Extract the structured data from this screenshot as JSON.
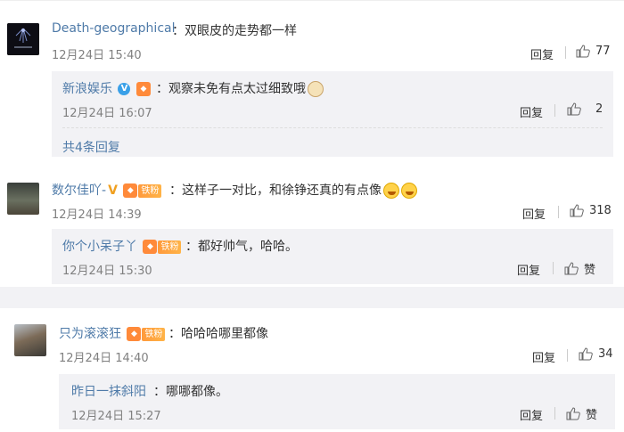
{
  "icons": {
    "like": "thumbs-up-icon",
    "verified": "v-badge-icon",
    "fan": "fan-badge-icon",
    "emoji": "emoji-icon"
  },
  "colors": {
    "name": "#4e7aa8",
    "reply_bg": "#f2f2f5",
    "verified_blue": "#3aa0e8",
    "verified_gold": "#f0a020",
    "badge_orange": "#ff8a3a"
  },
  "comments": [
    {
      "user": "Death-geographical",
      "text": "：双眼皮的走势都一样",
      "time": "12月24日 15:40",
      "reply_label": "回复",
      "likes": "77",
      "replies": [
        {
          "user": "新浪娱乐",
          "verified_mark": "V",
          "text": "：观察未免有点太过细致哦",
          "time": "12月24日 16:07",
          "reply_label": "回复",
          "likes": "2"
        }
      ],
      "more_replies": "共4条回复"
    },
    {
      "user": "数尔佳吖-",
      "verified_mark": "V",
      "fan_badge": "铁粉",
      "text": "：这样子一对比，和徐铮还真的有点像",
      "time": "12月24日 14:39",
      "reply_label": "回复",
      "likes": "318",
      "replies": [
        {
          "user": "你个小呆子丫",
          "fan_badge": "铁粉",
          "text": "：都好帅气，哈哈。",
          "time": "12月24日 15:30",
          "reply_label": "回复",
          "likes": "赞"
        }
      ]
    },
    {
      "user": "只为滚滚狂",
      "fan_badge": "铁粉",
      "text": "：哈哈哈哪里都像",
      "time": "12月24日 14:40",
      "reply_label": "回复",
      "likes": "34",
      "replies": [
        {
          "user": "昨日一抹斜阳",
          "text": "：哪哪都像。",
          "time": "12月24日 15:27",
          "reply_label": "回复",
          "likes": "赞"
        }
      ]
    }
  ]
}
